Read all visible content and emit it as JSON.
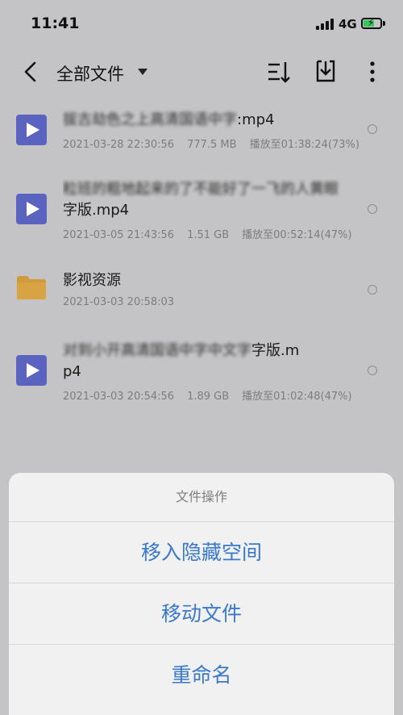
{
  "status_bar": {
    "time": "11:41",
    "network": "4G"
  },
  "toolbar": {
    "title": "全部文件"
  },
  "files": [
    {
      "name_blurred": "拔古劫色之上高清国语中字",
      "name_visible": ":mp4",
      "date": "2021-03-28 22:30:56",
      "size": "777.5 MB",
      "progress": "播放至01:38:24(73%)"
    },
    {
      "name_blurred": "粒班的粗地起来的了不能好了一飞的人黄眼",
      "name_line2": "字版.mp4",
      "date": "2021-03-05 21:43:56",
      "size": "1.51 GB",
      "progress": "播放至00:52:14(47%)"
    },
    {
      "name": "影视资源",
      "date": "2021-03-03 20:58:03"
    },
    {
      "name_blurred": "对到小开高清国语中字中文字",
      "name_visible": "字版.m",
      "name_line2": "p4",
      "date": "2021-03-03 20:54:56",
      "size": "1.89 GB",
      "progress": "播放至01:02:48(47%)"
    }
  ],
  "action_sheet": {
    "title": "文件操作",
    "options": [
      "移入隐藏空间",
      "移动文件",
      "重命名"
    ]
  },
  "colors": {
    "accent": "#3a78c9",
    "video_icon": "#5a64c0",
    "folder": "#d19a3a"
  }
}
